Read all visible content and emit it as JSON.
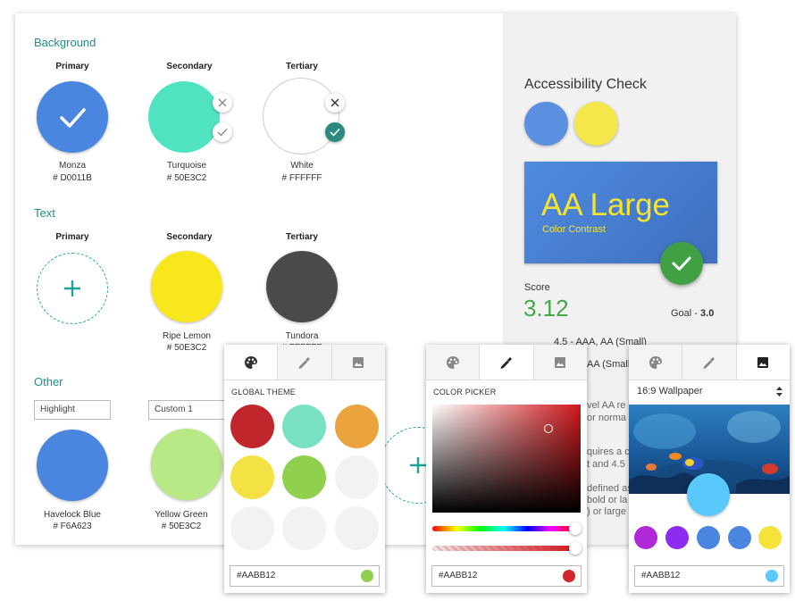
{
  "sections": {
    "background": "Background",
    "text": "Text",
    "other": "Other"
  },
  "labels": {
    "primary": "Primary",
    "secondary": "Secondary",
    "tertiary": "Tertiary"
  },
  "background": {
    "primary": {
      "name": "Monza",
      "hex": "# D0011B",
      "color": "#4a86df"
    },
    "secondary": {
      "name": "Turquoise",
      "hex": "# 50E3C2",
      "color": "#50e3c2"
    },
    "tertiary": {
      "name": "White",
      "hex": "# FFFFFF",
      "color": "#ffffff"
    }
  },
  "text_colors": {
    "secondary": {
      "name": "Ripe Lemon",
      "hex": "# 50E3C2",
      "color": "#f8e71c"
    },
    "tertiary": {
      "name": "Tundora",
      "hex": "# FFFFFF",
      "color": "#4a4a4a"
    }
  },
  "other": {
    "input1": "Highlight",
    "input2": "Custom 1",
    "swatch1": {
      "name": "Havelock Blue",
      "hex": "# F6A623",
      "color": "#4a86df"
    },
    "swatch2": {
      "name": "Yellow Green",
      "hex": "# 50E3C2",
      "color": "#b8e986"
    }
  },
  "accessibility": {
    "title": "Accessibility Check",
    "swatch_a": "#5b8fe0",
    "swatch_b": "#f5e64b",
    "preview_big": "AA Large",
    "preview_small": "Color Contrast",
    "score_label": "Score",
    "score": "3.12",
    "goal_label": "Goal - ",
    "goal": "3.0",
    "line1": "4.5 - AAA, AA (Small)",
    "line2": "AA (Small",
    "line3": "vel AA re",
    "line4": "or norma",
    "line5": "quires a c",
    "line6": "t and 4.5",
    "line7": "defined as",
    "line8": "bold or la",
    "line9": ") or large"
  },
  "popup_theme": {
    "heading": "GLOBAL THEME",
    "hex": "#AABB12",
    "dot_color": "#8fd14f",
    "swatches": [
      "#c0262b",
      "#79e0c4",
      "#eba33e",
      "#f4e244",
      "#8fd14f",
      "#f2f2f2",
      "#f2f2f2",
      "#f2f2f2",
      "#f2f2f2"
    ]
  },
  "popup_picker": {
    "heading": "COLOR PICKER",
    "hex": "#AABB12",
    "dot_color": "#d0262b"
  },
  "popup_wallpaper": {
    "select": "16:9 Wallpaper",
    "hex": "#AABB12",
    "dot_color": "#5ac8fa",
    "swatches": [
      "#b028d8",
      "#8d2cf0",
      "#4a86df",
      "#4a86df",
      "#f5e23a"
    ],
    "selected_color": "#5ac8fa"
  },
  "icons": {
    "palette": "palette-icon",
    "dropper": "eyedropper-icon",
    "image": "image-icon"
  }
}
